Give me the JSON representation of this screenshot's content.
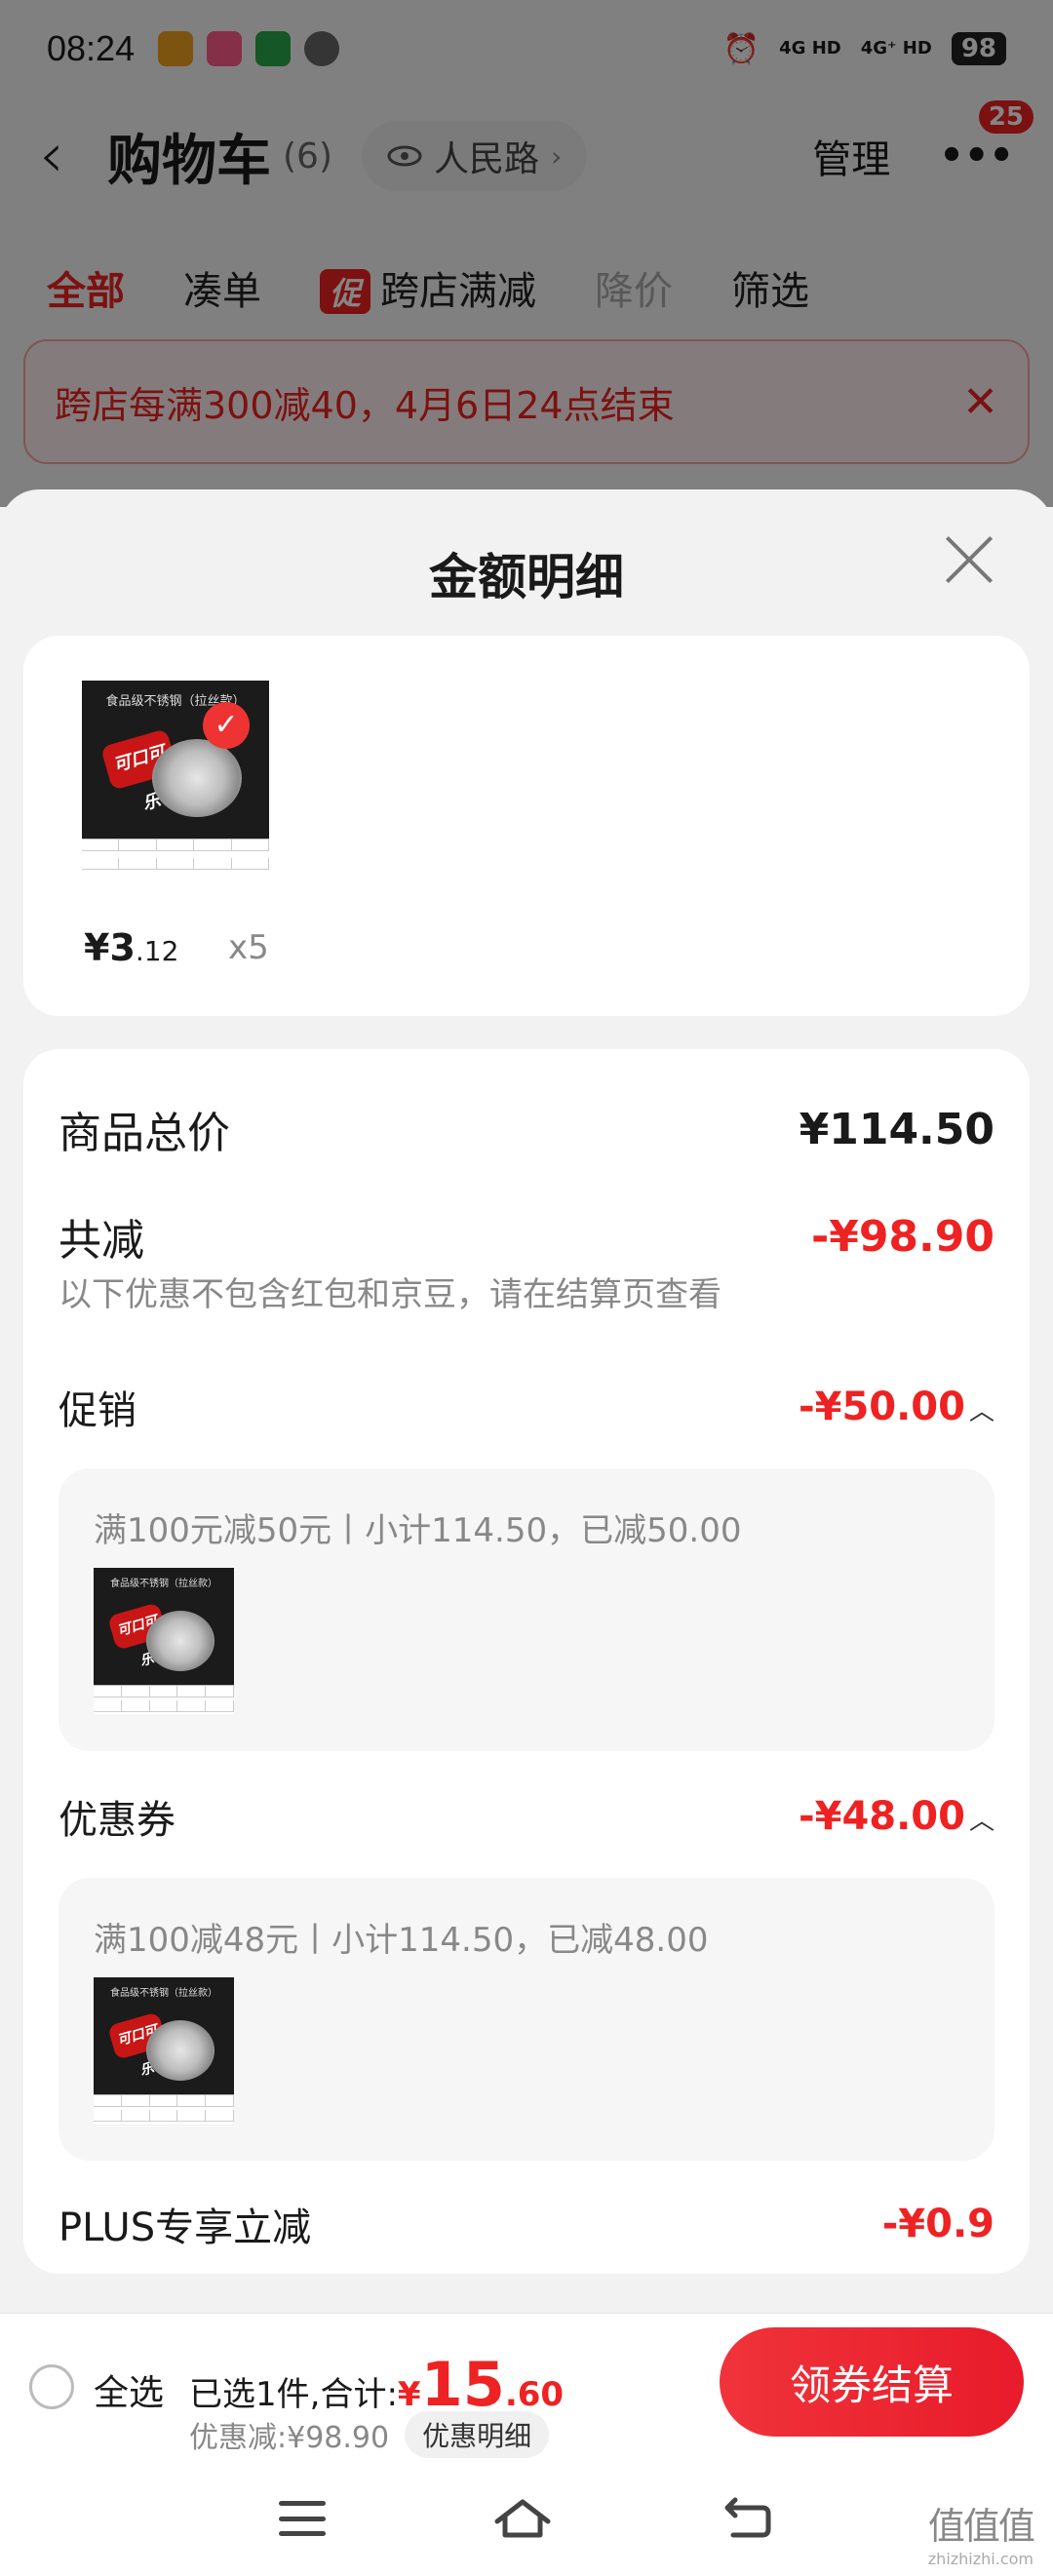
{
  "status_bar": {
    "time": "08:24",
    "network_1": "4G HD",
    "network_2": "4G⁺ HD",
    "battery": "98"
  },
  "nav": {
    "title": "购物车",
    "count": "(6)",
    "location": "人民路",
    "manage": "管理",
    "message_badge": "25"
  },
  "tabs": {
    "all": "全部",
    "combine": "凑单",
    "promo_tag": "促",
    "cross_store": "跨店满减",
    "price_drop": "降价",
    "filter": "筛选"
  },
  "promo_banner": {
    "text": "跨店每满300减40，4月6日24点结束"
  },
  "sheet": {
    "title": "金额明细",
    "product": {
      "image_caption": "食品级不锈钢（拉丝款）",
      "can_text": "可口可乐",
      "price_int": "¥3",
      "price_dec": ".12",
      "qty": "x5"
    },
    "summary": {
      "total_label": "商品总价",
      "total_value": "¥114.50",
      "reduce_label": "共减",
      "reduce_value": "-¥98.90",
      "hint": "以下优惠不包含红包和京豆，请在结算页查看"
    },
    "promotion": {
      "label": "促销",
      "value": "-¥50.00",
      "detail": "满100元减50元丨小计114.50，已减50.00"
    },
    "coupon": {
      "label": "优惠券",
      "value": "-¥48.00",
      "detail": "满100减48元丨小计114.50，已减48.00"
    },
    "plus": {
      "label": "PLUS专享立减",
      "value": "-¥0.9"
    }
  },
  "checkout": {
    "select_all": "全选",
    "selected_text": "已选1件,合计:",
    "total_yen": "¥",
    "total_int": "15",
    "total_dec": ".60",
    "discount_text": "优惠减:¥98.90",
    "detail_link": "优惠明细",
    "button": "领券结算"
  },
  "watermark": {
    "glyphs": "值值值",
    "text": "zhizhizhi.com"
  },
  "colors": {
    "accent_red": "#e22222",
    "overlay": "rgba(0,0,0,0.48)"
  },
  "icons": [
    "back-arrow-icon",
    "eye-icon",
    "chevron-right-icon",
    "more-dots-icon",
    "close-icon",
    "chevron-up-icon",
    "menu-icon",
    "home-icon",
    "back-icon"
  ]
}
